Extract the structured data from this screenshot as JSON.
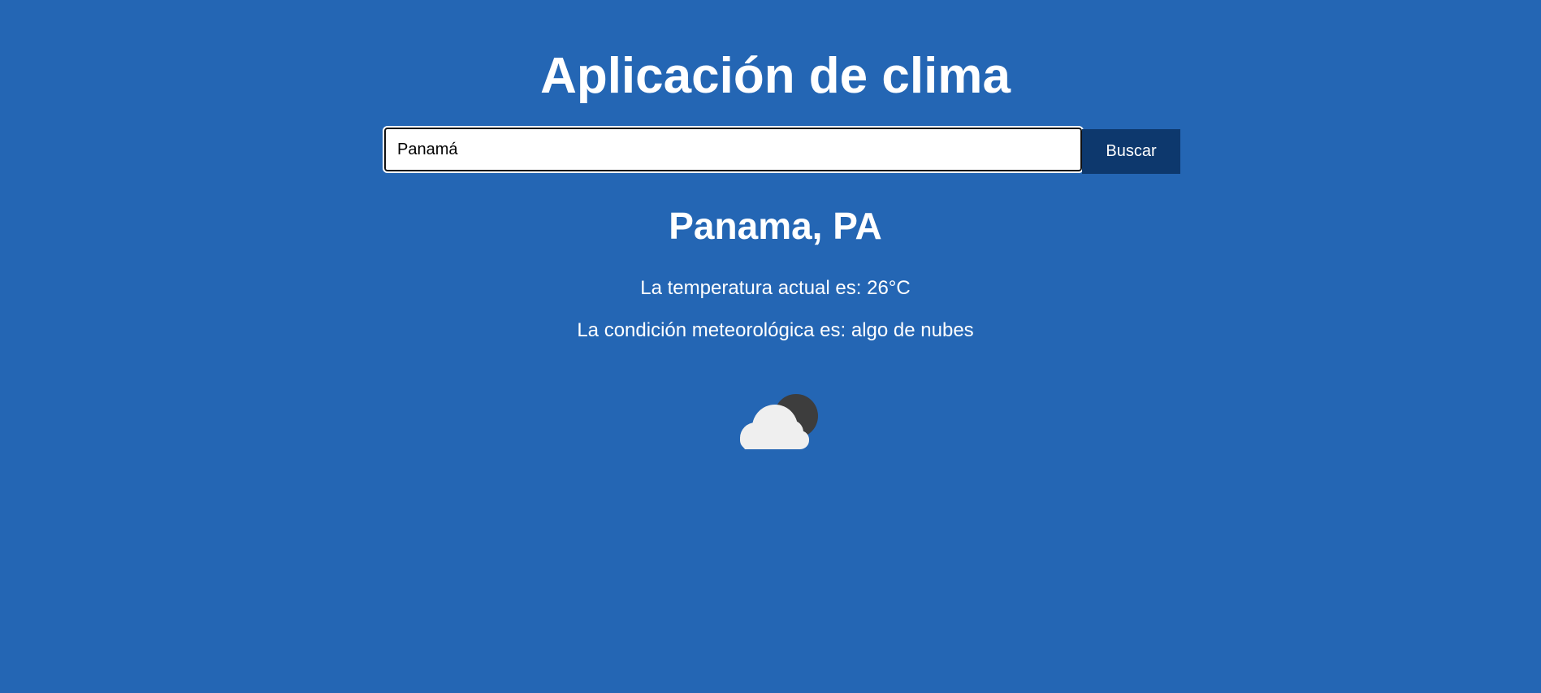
{
  "app": {
    "title": "Aplicación de clima"
  },
  "search": {
    "value": "Panamá",
    "button_label": "Buscar"
  },
  "weather": {
    "city": "Panama, PA",
    "temperature_text": "La temperatura actual es: 26°C",
    "condition_text": "La condición meteorológica es: algo de nubes",
    "icon": "partly-cloudy-night-icon"
  },
  "colors": {
    "background": "#2466b4",
    "button": "#0d386d",
    "text": "#ffffff"
  }
}
